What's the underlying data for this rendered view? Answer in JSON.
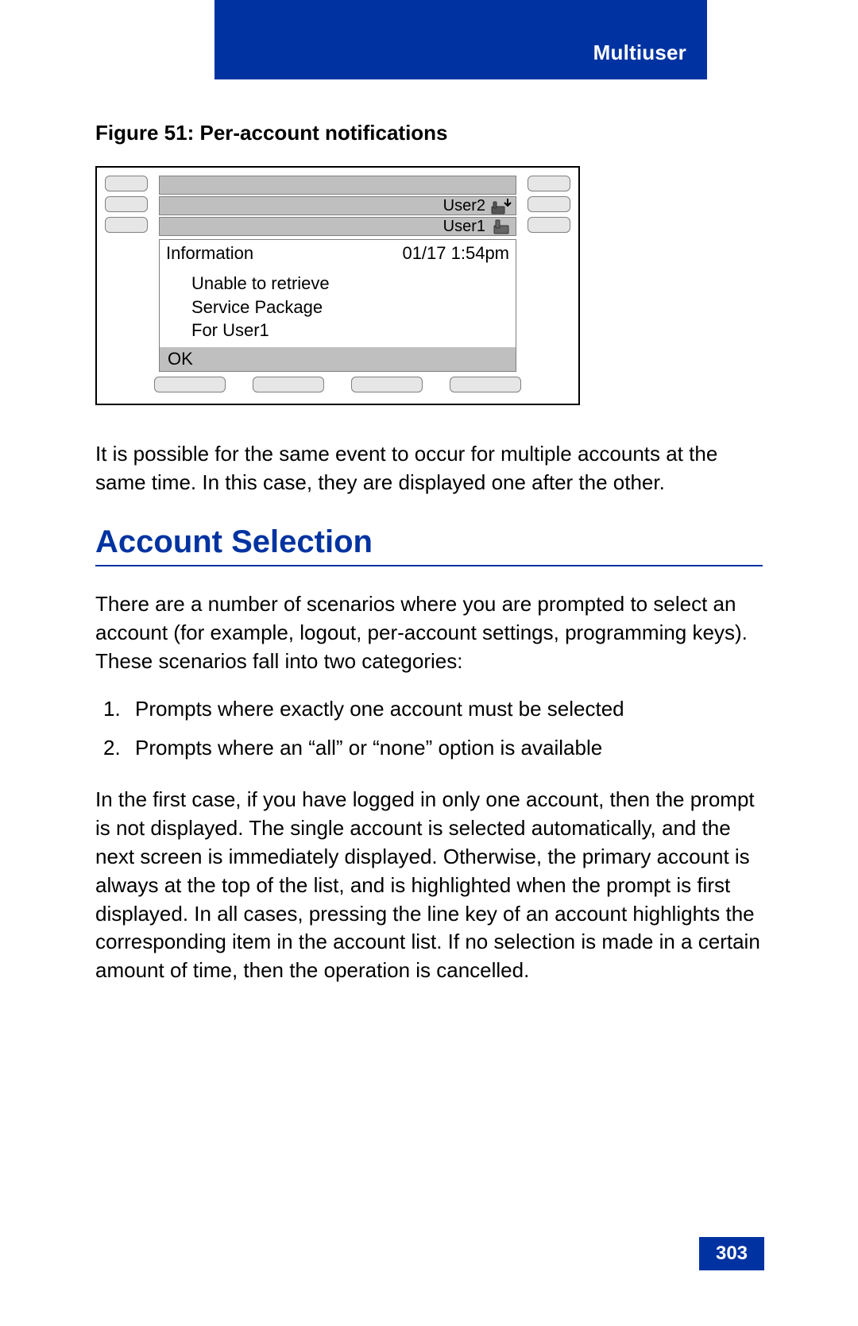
{
  "header": {
    "chapter": "Multiuser"
  },
  "figure": {
    "caption": "Figure 51: Per-account notifications",
    "lines": {
      "user2": "User2",
      "user1": "User1"
    },
    "info": {
      "title": "Information",
      "timestamp": "01/17 1:54pm",
      "body_line1": "Unable to retrieve",
      "body_line2": "Service Package",
      "body_line3": "For User1",
      "ok": "OK"
    }
  },
  "para_after_figure": "It is possible for the same event to occur for multiple accounts at the same time. In this case, they are displayed one after the other.",
  "section": {
    "title": "Account Selection"
  },
  "para_intro": "There are a number of scenarios where you are prompted to select an account (for example, logout, per-account settings, programming keys). These scenarios fall into two categories:",
  "list": {
    "item1_num": "1.",
    "item1_text": "Prompts where exactly one account must be selected",
    "item2_num": "2.",
    "item2_text": "Prompts where an “all” or “none” option is available"
  },
  "para_body": "In the first case, if you have logged in only one account, then the prompt is not displayed. The single account is selected automatically, and the next screen is immediately displayed. Otherwise, the primary account is always at the top of the list, and is highlighted when the prompt is first displayed. In all cases, pressing the line key of an account highlights the corresponding item in the account list. If no selection is made in a certain amount of time, then the operation is cancelled.",
  "page_number": "303"
}
